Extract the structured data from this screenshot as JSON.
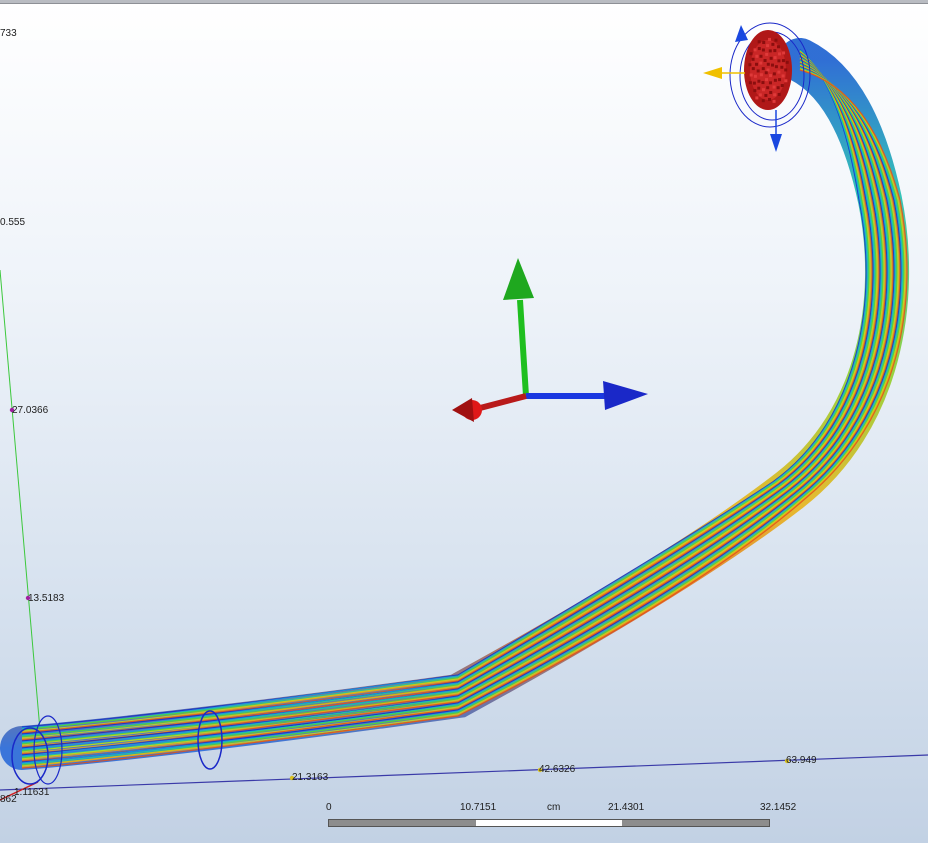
{
  "axis_labels": {
    "y_ticks": [
      "733",
      "0.555",
      "27.0366",
      "13.5183"
    ],
    "x_ticks": [
      "21.3163",
      "42.6326",
      "63.949"
    ],
    "origin_labels": [
      "1.11631",
      "862"
    ]
  },
  "scale_bar": {
    "labels": [
      "0",
      "10.7151",
      "cm",
      "21.4301",
      "32.1452"
    ]
  },
  "gizmo": {
    "x_axis_color": "#d11a1a",
    "y_axis_color": "#1fbf1f",
    "z_axis_color": "#1a38e0"
  },
  "streamline_colors": [
    "#1030c8",
    "#16a0e0",
    "#1fcf9a",
    "#5fd02a",
    "#c8d820",
    "#f0a018",
    "#e0501a"
  ]
}
